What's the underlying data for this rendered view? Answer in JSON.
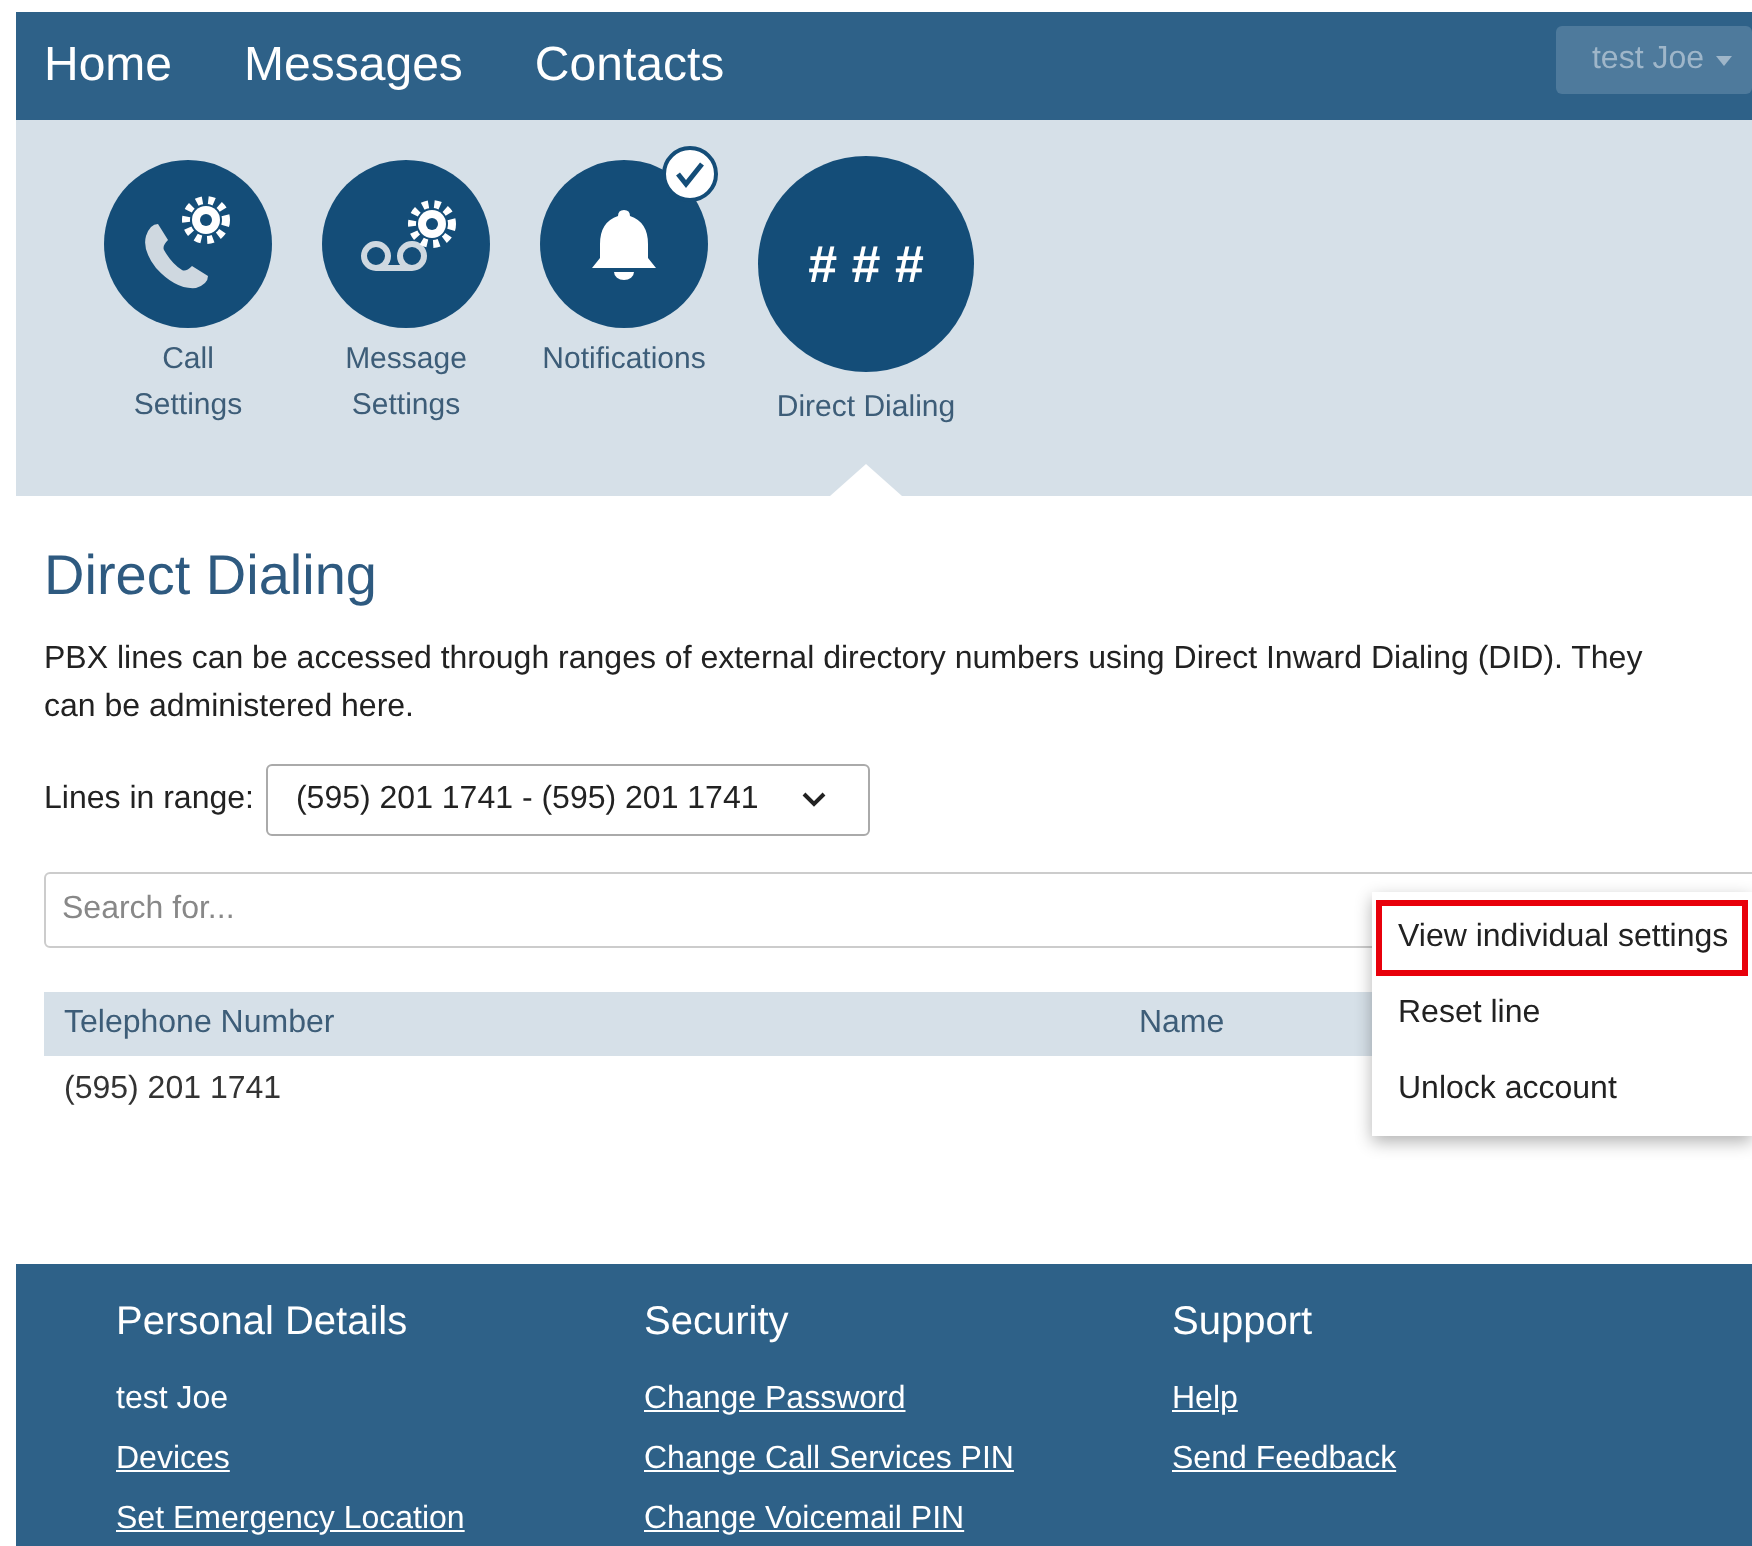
{
  "nav": {
    "items": [
      "Home",
      "Messages",
      "Contacts"
    ],
    "user_menu": "test Joe"
  },
  "features": [
    {
      "kind": "call",
      "label": "Call Settings",
      "selected": false,
      "checked": false
    },
    {
      "kind": "message",
      "label": "Message Settings",
      "selected": false,
      "checked": false
    },
    {
      "kind": "bell",
      "label": "Notifications",
      "selected": false,
      "checked": true
    },
    {
      "kind": "hash",
      "label": "Direct Dialing",
      "selected": true,
      "checked": false,
      "glyph": "# # #"
    }
  ],
  "heading": "Direct Dialing",
  "description": "PBX lines can be accessed through ranges of external directory numbers using Direct Inward Dialing (DID). They can be administered here.",
  "range": {
    "label": "Lines in range:",
    "value": "(595) 201 1741 - (595) 201 1741"
  },
  "search": {
    "placeholder": "Search for..."
  },
  "table": {
    "columns": [
      "Telephone Number",
      "Name"
    ],
    "rows": [
      [
        "(595) 201 1741",
        ""
      ]
    ]
  },
  "context_menu": [
    {
      "label": "View individual settings",
      "highlighted": true
    },
    {
      "label": "Reset line",
      "highlighted": false
    },
    {
      "label": "Unlock account",
      "highlighted": false
    }
  ],
  "footer": [
    {
      "title": "Personal Details",
      "items": [
        {
          "label": "test Joe",
          "link": false
        },
        {
          "label": "Devices",
          "link": true
        },
        {
          "label": "Set Emergency Location",
          "link": true
        }
      ]
    },
    {
      "title": "Security",
      "items": [
        {
          "label": "Change Password",
          "link": true
        },
        {
          "label": "Change Call Services PIN",
          "link": true
        },
        {
          "label": "Change Voicemail PIN",
          "link": true
        }
      ]
    },
    {
      "title": "Support",
      "items": [
        {
          "label": "Help",
          "link": true
        },
        {
          "label": "Send Feedback",
          "link": true
        }
      ]
    }
  ]
}
